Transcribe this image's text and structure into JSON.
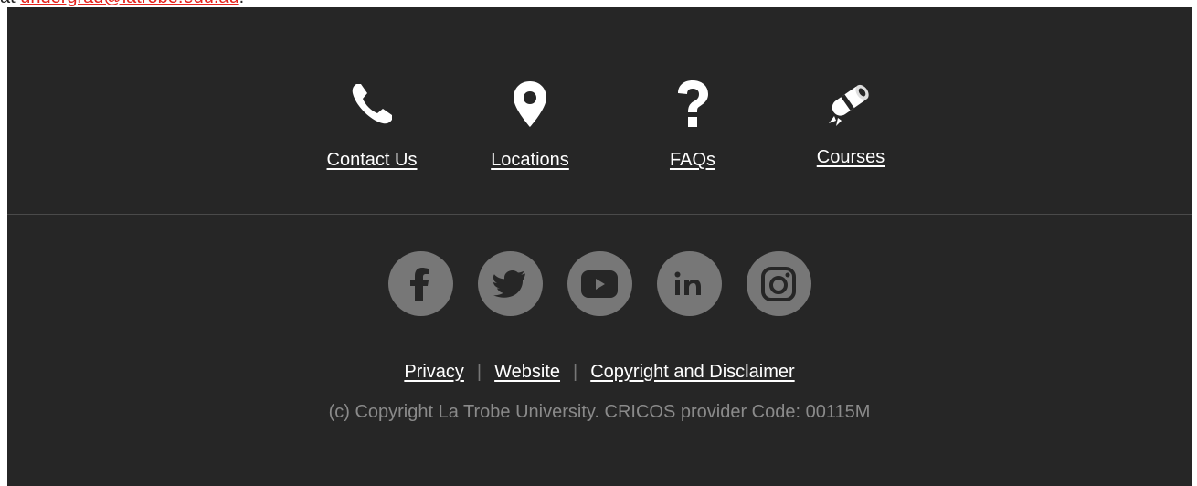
{
  "top_fragment": {
    "prefix": "at ",
    "link_text": "undergrad@latrobe.edu.au",
    "suffix": "."
  },
  "quick_links": [
    {
      "label": "Contact Us",
      "icon": "phone-icon"
    },
    {
      "label": "Locations",
      "icon": "map-pin-icon"
    },
    {
      "label": "FAQs",
      "icon": "question-icon"
    },
    {
      "label": "Courses",
      "icon": "diploma-icon"
    }
  ],
  "social": [
    {
      "icon": "facebook-icon",
      "glyph": "f"
    },
    {
      "icon": "twitter-icon"
    },
    {
      "icon": "youtube-icon"
    },
    {
      "icon": "linkedin-icon",
      "glyph": "in"
    },
    {
      "icon": "instagram-icon"
    }
  ],
  "legal_links": {
    "privacy": "Privacy",
    "website": "Website",
    "copyright": "Copyright and Disclaimer",
    "separator": "|"
  },
  "copyright_text": "(c) Copyright La Trobe University. CRICOS provider Code: 00115M",
  "colors": {
    "footer_bg": "#262626",
    "link": "#ffffff",
    "social_circle": "#777777",
    "muted_text": "#8a8a8a",
    "accent_link": "#e4211b"
  }
}
